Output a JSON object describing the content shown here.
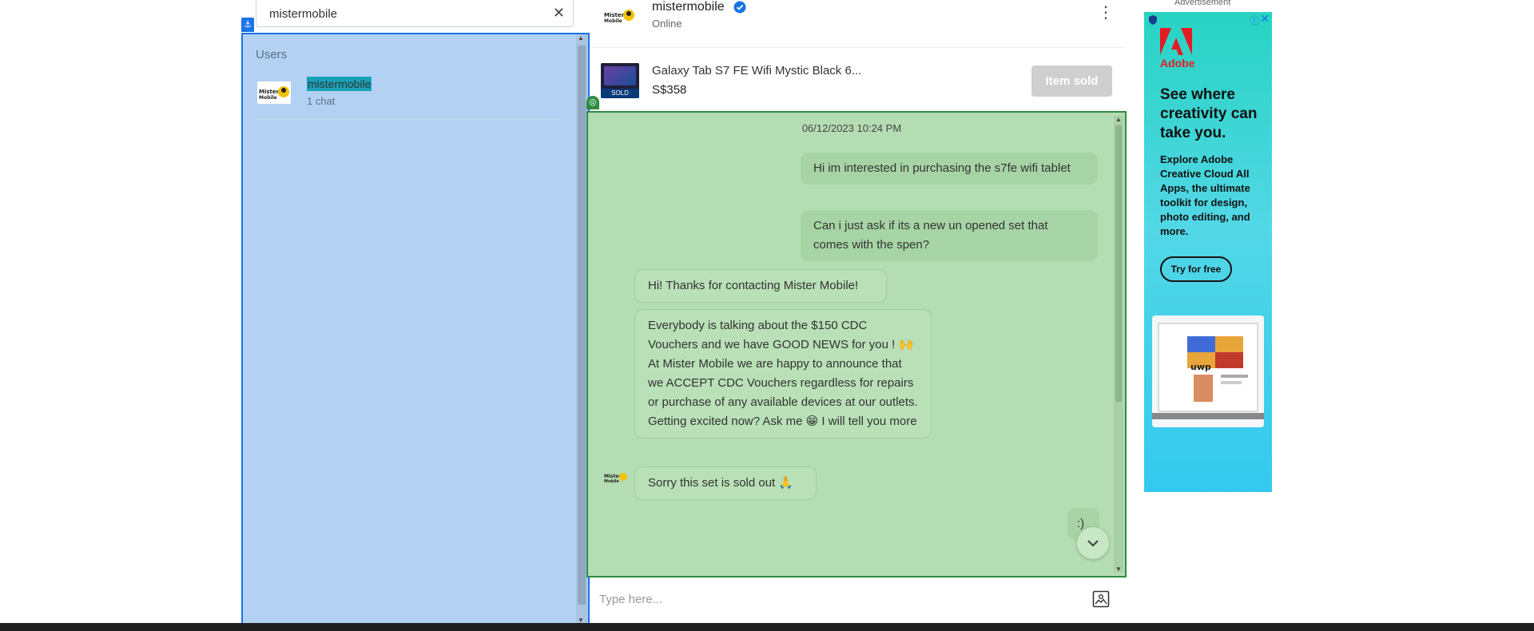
{
  "search": {
    "value": "mistermobile",
    "clear_icon": "close-icon"
  },
  "users": {
    "heading": "Users",
    "items": [
      {
        "name": "mistermobile",
        "chats": "1 chat"
      }
    ]
  },
  "chat": {
    "name": "mistermobile",
    "status": "Online",
    "listing": {
      "title": "Galaxy Tab S7 FE Wifi Mystic Black 6...",
      "price": "S$358",
      "badge": "SOLD",
      "button": "Item sold"
    },
    "timestamp": "06/12/2023  10:24 PM",
    "messages": [
      {
        "dir": "out",
        "text": "Hi im interested in purchasing the s7fe wifi tablet"
      },
      {
        "dir": "out",
        "text": "Can i just ask if its a new un opened set that comes with the spen?"
      },
      {
        "dir": "in",
        "text": "Hi! Thanks for contacting Mister Mobile!"
      },
      {
        "dir": "in",
        "text": "Everybody is talking about the $150 CDC Vouchers and we have GOOD NEWS for you ! 🙌  At Mister Mobile we are happy to announce that we ACCEPT CDC Vouchers regardless for repairs or purchase of any available devices at our outlets. Getting excited now? Ask me 😁  I will tell you more"
      },
      {
        "dir": "in",
        "text": "Sorry this set is sold out 🙏"
      },
      {
        "dir": "out",
        "text": ":)"
      }
    ],
    "input_placeholder": "Type here..."
  },
  "ad": {
    "label": "Advertisement",
    "brand": "Adobe",
    "headline": "See where creativity can take you.",
    "body": "Explore Adobe Creative Cloud All Apps, the ultimate toolkit for design, photo editing, and more.",
    "cta": "Try for free",
    "choices_icon": "info-icon",
    "close_icon": "close-icon"
  },
  "colors": {
    "users_overlay": "#b3d1f2",
    "users_border": "#1a73e8",
    "messages_overlay": "#b5ddb3",
    "messages_border": "#2e8b3e",
    "verified": "#1a73e8",
    "adobe_red": "#e51b24"
  }
}
